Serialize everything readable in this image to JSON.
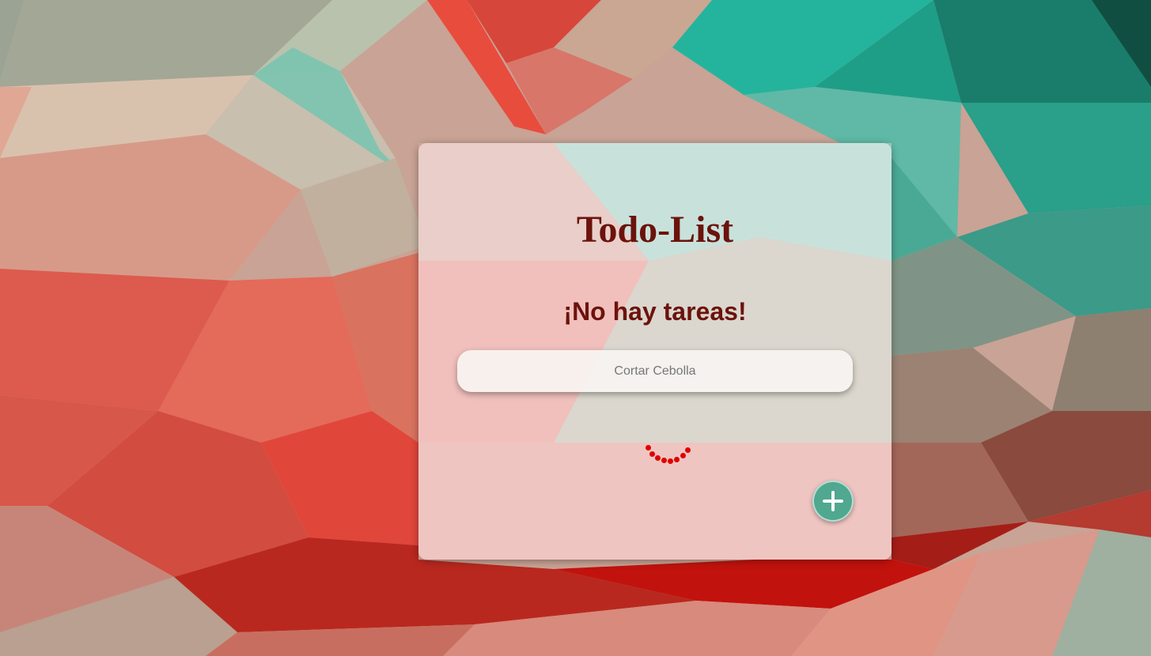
{
  "app": {
    "title": "Todo-List",
    "empty_message": "¡No hay tareas!"
  },
  "task_input": {
    "value": "",
    "placeholder": "Cortar Cebolla"
  },
  "add_button": {
    "icon": "plus-icon"
  },
  "loading": {
    "icon": "loading-spinner-icon",
    "color": "#e00000"
  },
  "colors": {
    "heading": "#6b130c",
    "add_button": "#4fa88f",
    "card": "rgba(255,255,255,0.38)"
  }
}
